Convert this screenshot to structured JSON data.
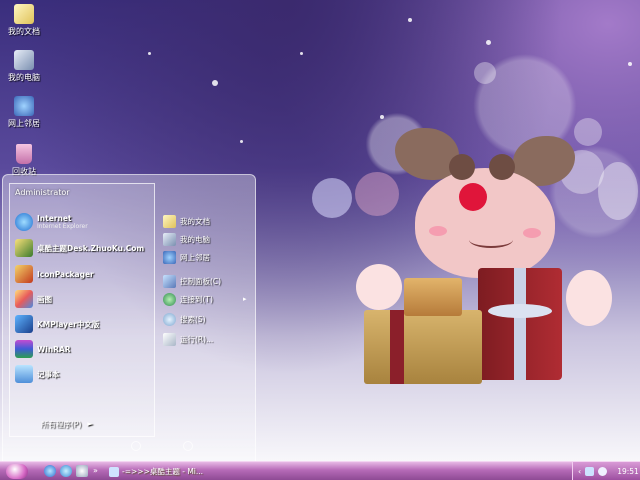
{
  "desktop_icons": [
    {
      "label": "我的文档",
      "icon": "my-documents-icon"
    },
    {
      "label": "我的电脑",
      "icon": "my-computer-icon"
    },
    {
      "label": "网上邻居",
      "icon": "network-places-icon"
    },
    {
      "label": "回收站",
      "icon": "recycle-bin-icon"
    }
  ],
  "start_menu": {
    "user_name": "Administrator",
    "pinned": [
      {
        "label": "Internet",
        "sublabel": "Internet Explorer",
        "icon": "ie-icon"
      },
      {
        "label": "桌酷主题Desk.ZhuoKu.Com",
        "icon": "zhuoku-icon"
      },
      {
        "label": "IconPackager",
        "icon": "iconpackager-icon"
      },
      {
        "label": "画图",
        "icon": "paint-icon"
      },
      {
        "label": "KMPlayer中文版",
        "icon": "kmplayer-icon"
      },
      {
        "label": "WinRAR",
        "icon": "winrar-icon"
      },
      {
        "label": "记事本",
        "icon": "notepad-icon"
      }
    ],
    "all_programs": "所有程序(P)",
    "right_items": [
      {
        "label": "我的文档",
        "icon": "my-documents-icon"
      },
      {
        "label": "我的电脑",
        "icon": "my-computer-icon"
      },
      {
        "label": "网上邻居",
        "icon": "network-places-icon"
      },
      {
        "label": "控制面板(C)",
        "icon": "control-panel-icon"
      },
      {
        "label": "连接到(T)",
        "icon": "connect-to-icon"
      },
      {
        "label": "搜索(S)",
        "icon": "search-icon"
      },
      {
        "label": "运行(R)...",
        "icon": "run-icon"
      }
    ]
  },
  "taskbar": {
    "task_label": "-=>>>桌酷主题 - Mi...",
    "clock": "19:51"
  },
  "colors": {
    "taskbar": "#b66ab7",
    "accent": "#d86cc7"
  }
}
